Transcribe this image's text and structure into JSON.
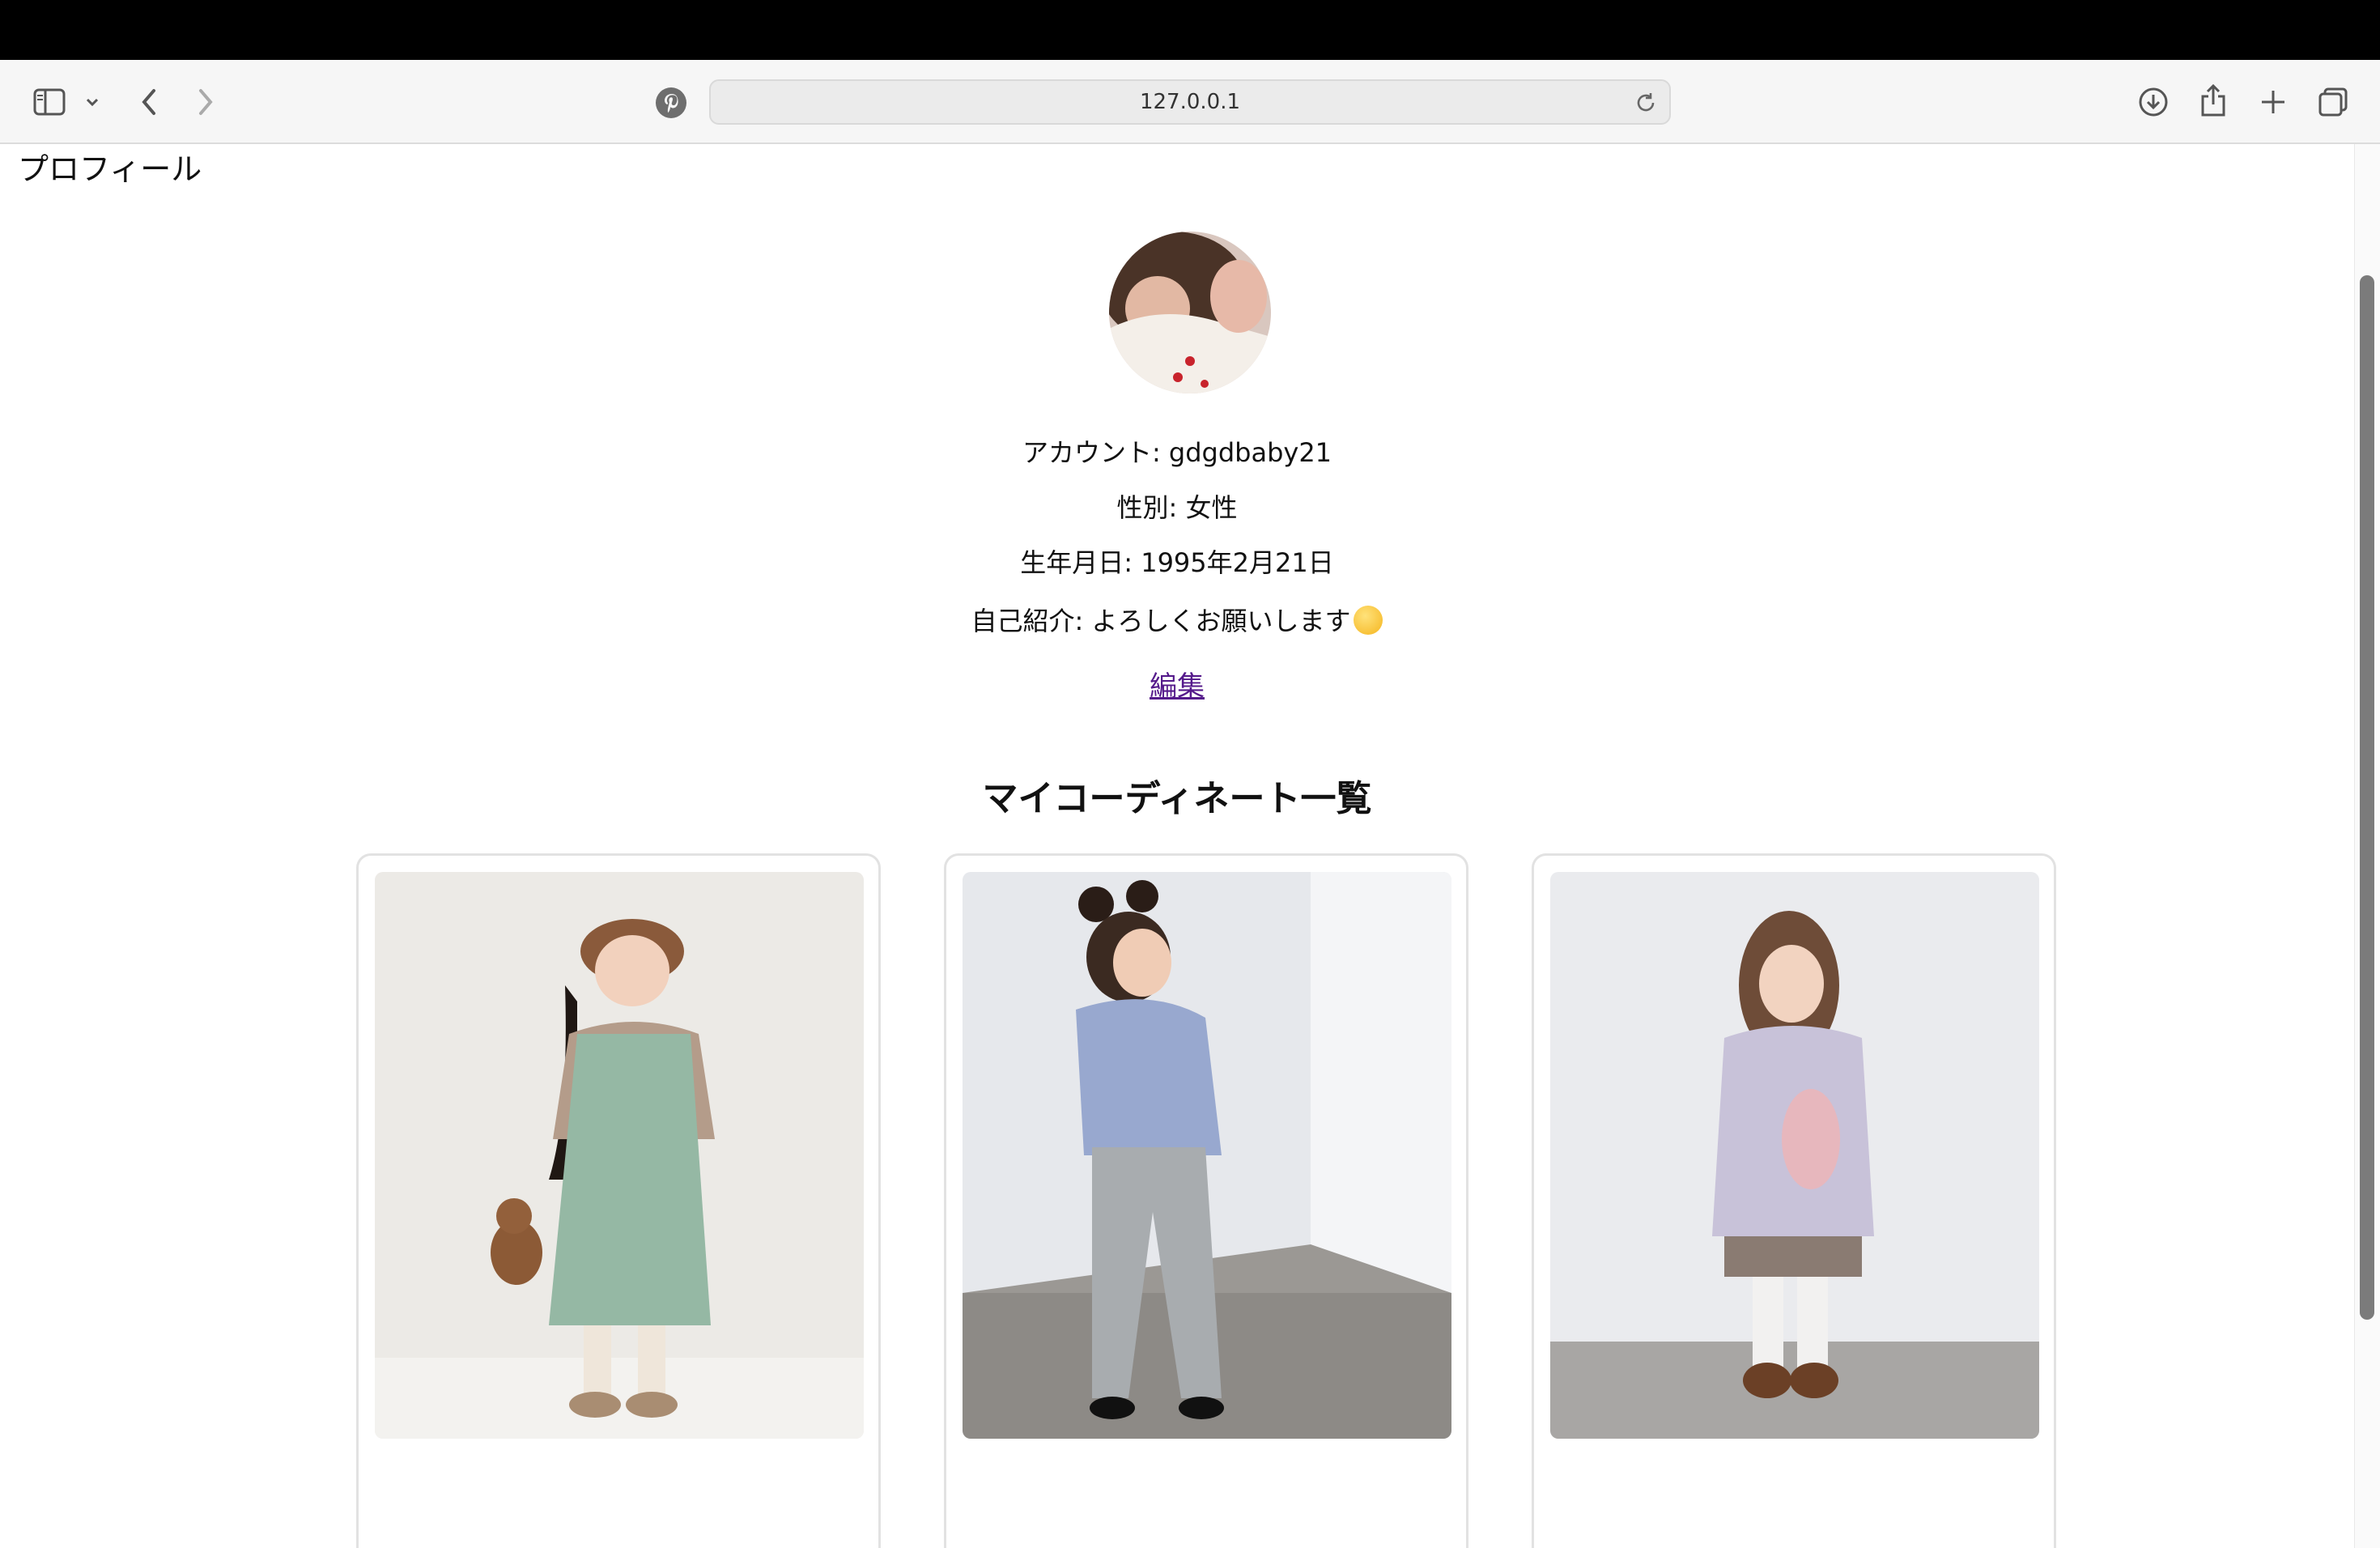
{
  "browser": {
    "url": "127.0.0.1"
  },
  "page": {
    "heading": "プロフィール",
    "account_line": "アカウント: gdgdbaby21",
    "gender_line": "性別: 女性",
    "birthday_line": "生年月日: 1995年2月21日",
    "intro_line": "自己紹介: よろしくお願いします",
    "edit_label": "編集",
    "section_title": "マイコーディネート一覧"
  },
  "coordinates": [
    {
      "description": "photo-girl-beret-green-skirt"
    },
    {
      "description": "photo-girl-blue-sweater-jeans"
    },
    {
      "description": "photo-girl-lavender-coat"
    }
  ],
  "colors": {
    "link": "#551a8b",
    "toolbar_bg": "#f6f6f6",
    "topbar": "#000000"
  }
}
